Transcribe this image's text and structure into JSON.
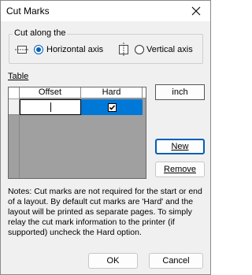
{
  "window": {
    "title": "Cut Marks"
  },
  "cut_along": {
    "label": "Cut along the",
    "horizontal": {
      "label": "Horizontal axis",
      "checked": true
    },
    "vertical": {
      "label": "Vertical axis",
      "checked": false
    }
  },
  "table": {
    "label": "Table",
    "columns": [
      "Offset",
      "Hard"
    ],
    "rows": [
      {
        "offset": "",
        "hard": true
      }
    ]
  },
  "buttons": {
    "units": "inch",
    "new": "New",
    "remove": "Remove",
    "ok": "OK",
    "cancel": "Cancel"
  },
  "notes": "Notes: Cut marks are not required for the start or end of a layout. By default cut marks are 'Hard' and the layout will be printed as separate pages. To simply relay the cut mark information to the printer (if supported) uncheck the Hard option.",
  "colors": {
    "accent": "#005fb8",
    "selection": "#0078d7"
  }
}
